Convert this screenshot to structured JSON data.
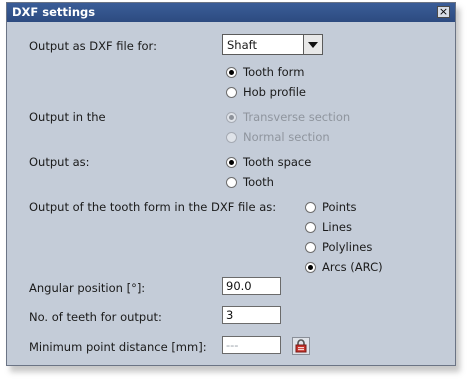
{
  "window": {
    "title": "DXF settings",
    "close_glyph": "×"
  },
  "output_file": {
    "label": "Output as DXF file for:",
    "selected": "Shaft",
    "options": [
      {
        "label": "Tooth form",
        "checked": true
      },
      {
        "label": "Hob profile",
        "checked": false
      }
    ]
  },
  "output_section": {
    "label": "Output in the",
    "options": [
      {
        "label": "Transverse section",
        "checked": true,
        "disabled": true
      },
      {
        "label": "Normal section",
        "checked": false,
        "disabled": true
      }
    ]
  },
  "output_as": {
    "label": "Output as:",
    "options": [
      {
        "label": "Tooth space",
        "checked": true
      },
      {
        "label": "Tooth",
        "checked": false
      }
    ]
  },
  "tooth_form_format": {
    "label": "Output of the tooth form in the DXF file as:",
    "options": [
      {
        "label": "Points",
        "checked": false
      },
      {
        "label": "Lines",
        "checked": false
      },
      {
        "label": "Polylines",
        "checked": false
      },
      {
        "label": "Arcs (ARC)",
        "checked": true
      }
    ]
  },
  "angular_position": {
    "label": "Angular position [°]:",
    "value": "90.0"
  },
  "teeth_output": {
    "label": "No. of teeth for output:",
    "value": "3"
  },
  "min_point_distance": {
    "label": "Minimum point distance [mm]:",
    "value": "---"
  },
  "icons": {
    "lock": "lock-icon",
    "close": "close-icon",
    "dropdown": "chevron-down-icon"
  }
}
